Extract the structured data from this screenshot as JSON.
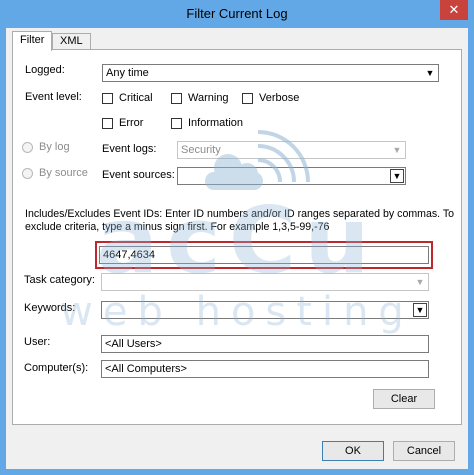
{
  "window": {
    "title": "Filter Current Log",
    "close_glyph": "✕"
  },
  "tabs": [
    {
      "label": "Filter"
    },
    {
      "label": "XML"
    }
  ],
  "logged": {
    "label": "Logged:",
    "value": "Any time"
  },
  "event_level": {
    "label": "Event level:",
    "options": [
      {
        "label": "Critical"
      },
      {
        "label": "Warning"
      },
      {
        "label": "Verbose"
      },
      {
        "label": "Error"
      },
      {
        "label": "Information"
      }
    ]
  },
  "source_mode": {
    "by_log": "By log",
    "by_source": "By source"
  },
  "event_logs": {
    "label": "Event logs:",
    "value": "Security"
  },
  "event_sources": {
    "label": "Event sources:",
    "value": ""
  },
  "event_ids": {
    "description_line1": "Includes/Excludes Event IDs: Enter ID numbers and/or ID ranges separated by commas. To",
    "description_line2": "exclude criteria, type a minus sign first. For example 1,3,5-99,-76",
    "value": "4647,4634"
  },
  "task_category": {
    "label": "Task category:",
    "value": ""
  },
  "keywords": {
    "label": "Keywords:",
    "value": ""
  },
  "user": {
    "label": "User:",
    "value": "<All Users>"
  },
  "computers": {
    "label": "Computer(s):",
    "value": "<All Computers>"
  },
  "buttons": {
    "clear": "Clear",
    "ok": "OK",
    "cancel": "Cancel"
  },
  "watermark": {
    "brand_top": "acCu",
    "brand_bottom": "web hosting"
  },
  "colors": {
    "title_bar": "#62a8e6",
    "close_button": "#c7433b",
    "highlight_border": "#c2262d",
    "watermark": "#8fb4d4"
  }
}
